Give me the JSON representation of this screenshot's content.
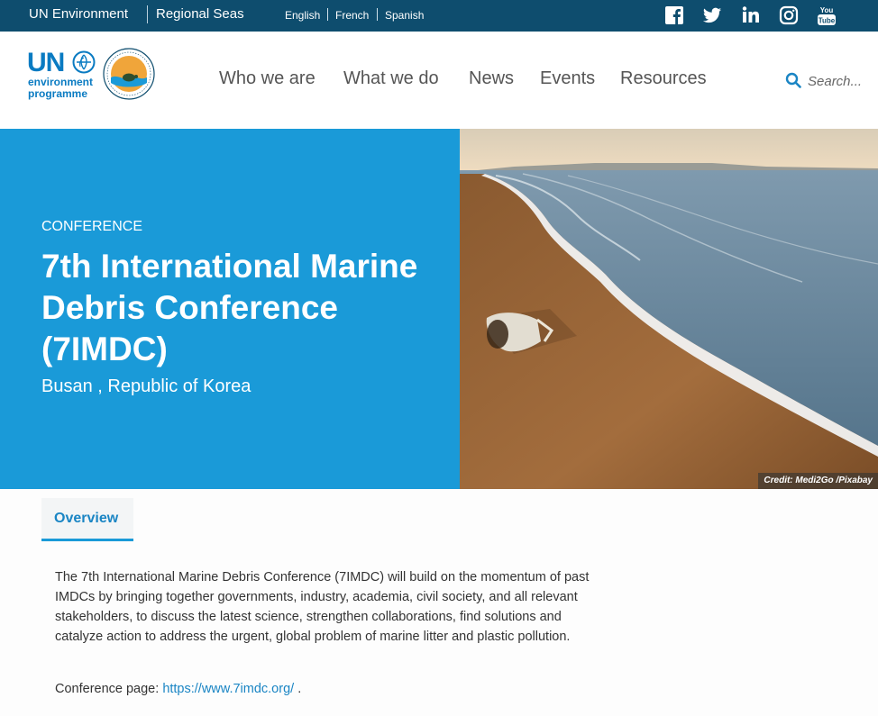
{
  "topbar": {
    "un_environment": "UN Environment",
    "regional_seas": "Regional Seas",
    "languages": [
      "English",
      "French",
      "Spanish"
    ]
  },
  "icons": {
    "social": [
      "facebook-icon",
      "twitter-icon",
      "linkedin-icon",
      "instagram-icon",
      "youtube-icon"
    ],
    "search": "search-icon",
    "un_logo_globe": "un-environment-globe-icon",
    "regional_seas_logo": "regional-seas-logo"
  },
  "header": {
    "logo": {
      "un": "UN",
      "line1": "environment",
      "line2": "programme"
    },
    "nav": [
      "Who we are",
      "What we do",
      "News",
      "Events",
      "Resources"
    ],
    "search_placeholder": "Search..."
  },
  "hero": {
    "tag": "CONFERENCE",
    "title": "7th International Marine Debris Conference (7IMDC)",
    "location": "Busan , Republic of Korea",
    "photo_credit": "Credit: Medi2Go /Pixabay"
  },
  "content": {
    "tab_overview": "Overview",
    "description": "The 7th International Marine Debris Conference (7IMDC) will build on the momentum of past IMDCs by bringing together governments, industry, academia, civil society, and all relevant stakeholders, to discuss the latest science, strengthen collaborations, find solutions and catalyze action to address the urgent, global problem of marine litter and plastic pollution.",
    "conference_page_label": "Conference page:",
    "conference_page_url": "https://www.7imdc.org/",
    "conference_page_suffix": "."
  },
  "colors": {
    "topbar": "#0e4d6e",
    "hero_blue": "#1a9ad8",
    "link_blue": "#1a85c4"
  }
}
